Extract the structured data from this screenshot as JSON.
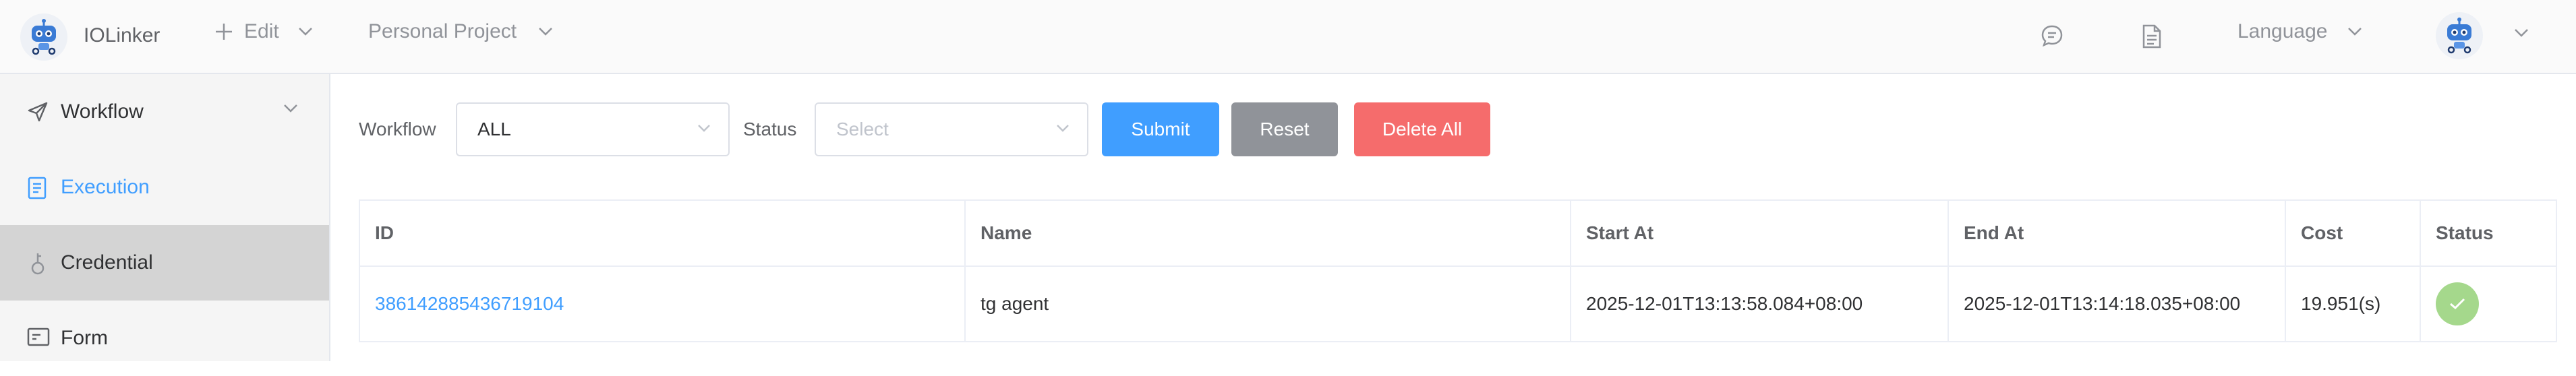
{
  "header": {
    "app_name": "IOLinker",
    "edit_label": "Edit",
    "project_label": "Personal Project",
    "language_label": "Language",
    "icons": [
      "robot-logo-icon",
      "plus-icon",
      "chat-icon",
      "document-icon",
      "chevron-down-icon"
    ]
  },
  "sidebar": {
    "items": [
      {
        "label": "Workflow",
        "icon": "send-icon",
        "state": "default"
      },
      {
        "label": "Execution",
        "icon": "document-icon",
        "state": "active"
      },
      {
        "label": "Credential",
        "icon": "key-icon",
        "state": "hover"
      },
      {
        "label": "Form",
        "icon": "form-icon",
        "state": "default"
      }
    ]
  },
  "filters": {
    "workflow_label": "Workflow",
    "workflow_value": "ALL",
    "status_label": "Status",
    "status_placeholder": "Select",
    "submit_label": "Submit",
    "reset_label": "Reset",
    "delete_all_label": "Delete All"
  },
  "table": {
    "columns": [
      "ID",
      "Name",
      "Start At",
      "End At",
      "Cost",
      "Status"
    ],
    "rows": [
      {
        "id": "386142885436719104",
        "name": "tg agent",
        "start_at": "2025-12-01T13:13:58.084+08:00",
        "end_at": "2025-12-01T13:14:18.035+08:00",
        "cost": "19.951(s)",
        "status": "success"
      }
    ]
  },
  "colors": {
    "primary": "#409eff",
    "info": "#909399",
    "danger": "#f56c6c",
    "success": "#a5d88c"
  }
}
